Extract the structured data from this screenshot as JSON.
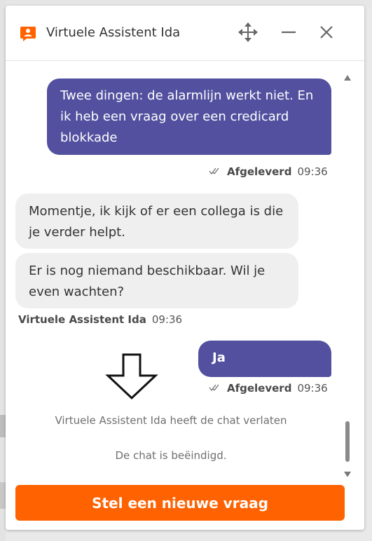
{
  "header": {
    "assistant_name": "Virtuele Assistent Ida",
    "icons": [
      "assistant-icon",
      "move-icon",
      "minimize-icon",
      "close-icon"
    ],
    "accent_color": "#ff6200"
  },
  "messages": [
    {
      "from": "user",
      "lines": [
        "Twee dingen: de alarmlijn werkt niet. En",
        "ik heb een vraag over een credicard",
        "blokkade"
      ],
      "status": "Afgeleverd",
      "time": "09:36"
    },
    {
      "from": "bot",
      "lines": [
        "Momentje, ik kijk of er een collega is die",
        "je verder helpt."
      ]
    },
    {
      "from": "bot",
      "lines": [
        "Er is nog niemand beschikbaar. Wil je",
        "even wachten?"
      ],
      "sender": "Virtuele Assistent Ida",
      "time": "09:36"
    },
    {
      "from": "user",
      "lines": [
        "Ja"
      ],
      "status": "Afgeleverd",
      "time": "09:36"
    }
  ],
  "system_notes": {
    "left_chat": "Virtuele Assistent Ida heeft de chat verlaten",
    "ended": "De chat is beëindigd."
  },
  "cta": {
    "label": "Stel een nieuwe vraag"
  },
  "colors": {
    "user_bubble": "#52509f",
    "bot_bubble": "#efefef",
    "cta": "#ff6200"
  }
}
